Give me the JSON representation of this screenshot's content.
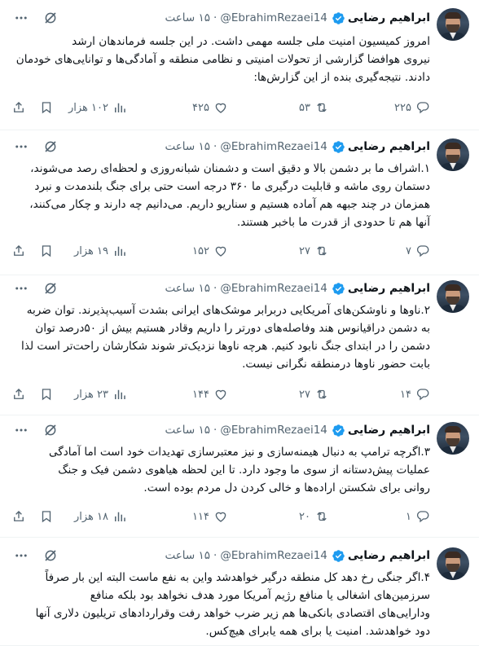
{
  "author": {
    "name": "ابراهیم رضایی",
    "handle": "@EbrahimRezaei14",
    "time": "۱۵ ساعت",
    "separator": "·",
    "verified": true
  },
  "colors": {
    "verified_badge": "#1d9bf0",
    "text": "#0f1419",
    "secondary_text": "#536471",
    "divider": "#eff3f4"
  },
  "tweets": [
    {
      "text": "امروز کمیسیون امنیت ملی جلسه مهمی داشت. در این جلسه فرماندهان ارشد\nنیروی هوافضا گزارشی از تحولات امنیتی و نظامی منطقه و آمادگی‌ها و توانایی‌های خودمان\nدادند. نتیجه‌گیری بنده از این گزارش‌ها:",
      "replies": "۲۲۵",
      "retweets": "۵۳",
      "likes": "۴۲۵",
      "views": "۱۰۲ هزار"
    },
    {
      "text": "۱.اشراف ما بر دشمن بالا و دقیق است و دشمنان شبانه‌روزی و لحظه‌ای رصد می‌شوند،\nدستمان روی ماشه و قابلیت درگیری ما ۳۶۰ درجه است حتی برای جنگ بلندمدت و نبرد\nهمزمان در چند جبهه هم آماده هستیم و سناریو داریم. می‌دانیم چه دارند و چکار می‌کنند،\nآنها هم تا حدودی از قدرت ما باخبر هستند.",
      "replies": "۷",
      "retweets": "۲۷",
      "likes": "۱۵۲",
      "views": "۱۹ هزار"
    },
    {
      "text": "۲.ناوها و ناوشکن‌های آمریکایی دربرابر موشک‌های ایرانی بشدت آسیب‌پذیرند. توان ضربه\nبه دشمن دراقیانوس هند وفاصله‌های دورتر را داریم وقادر هستیم بیش از ۵۰درصد توان\nدشمن را در ابتدای جنگ نابود کنیم. هرچه ناوها نزدیک‌تر شوند شکارشان راحت‌تر است لذا\nبابت حضور ناوها درمنطقه نگرانی نیست.",
      "replies": "۱۴",
      "retweets": "۲۷",
      "likes": "۱۴۴",
      "views": "۲۳ هزار"
    },
    {
      "text": "۳.اگرچه ترامپ به دنبال هیمنه‌سازی و نیز معتبرسازی تهدیدات خود است اما آمادگی\nعملیات پیش‌دستانه از سوی ما وجود دارد. تا این لحظه هیاهوی دشمن فیک و جنگ\nروانی برای شکستن اراده‌ها و خالی کردن دل مردم بوده است.",
      "replies": "۱",
      "retweets": "۲۰",
      "likes": "۱۱۴",
      "views": "۱۸ هزار"
    },
    {
      "text": "۴.اگر جنگی رخ دهد کل منطقه درگیر خواهدشد واین به نفع ماست البته این بار صرفاً\nسرزمین‌های اشغالی یا منافع رژیم آمریکا مورد هدف نخواهد بود بلکه منافع\nودارایی‌های اقتصادی بانکی‌ها هم زیر ضرب خواهد رفت وقراردادهای تریلیون دلاری آنها\nدود خواهدشد. امنیت یا برای همه یابرای هیچ‌کس."
    }
  ]
}
